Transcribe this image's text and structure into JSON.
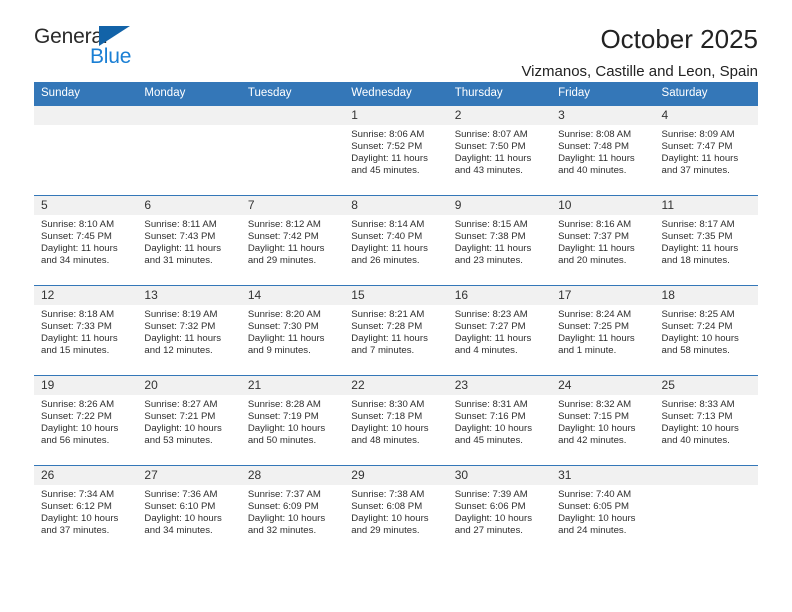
{
  "brand": {
    "name_part1": "General",
    "name_part2": "Blue",
    "triangle_icon": "triangle-icon",
    "accent_color": "#1a7fd4",
    "triangle_color": "#1263a8"
  },
  "header": {
    "title": "October 2025",
    "subtitle": "Vizmanos, Castille and Leon, Spain"
  },
  "calendar": {
    "header_bg": "#3477b8",
    "daynum_bg": "#f1f1f1",
    "weekday_headers": [
      "Sunday",
      "Monday",
      "Tuesday",
      "Wednesday",
      "Thursday",
      "Friday",
      "Saturday"
    ],
    "weeks": [
      [
        {
          "day": "",
          "lines": []
        },
        {
          "day": "",
          "lines": []
        },
        {
          "day": "",
          "lines": []
        },
        {
          "day": "1",
          "lines": [
            "Sunrise: 8:06 AM",
            "Sunset: 7:52 PM",
            "Daylight: 11 hours",
            "and 45 minutes."
          ]
        },
        {
          "day": "2",
          "lines": [
            "Sunrise: 8:07 AM",
            "Sunset: 7:50 PM",
            "Daylight: 11 hours",
            "and 43 minutes."
          ]
        },
        {
          "day": "3",
          "lines": [
            "Sunrise: 8:08 AM",
            "Sunset: 7:48 PM",
            "Daylight: 11 hours",
            "and 40 minutes."
          ]
        },
        {
          "day": "4",
          "lines": [
            "Sunrise: 8:09 AM",
            "Sunset: 7:47 PM",
            "Daylight: 11 hours",
            "and 37 minutes."
          ]
        }
      ],
      [
        {
          "day": "5",
          "lines": [
            "Sunrise: 8:10 AM",
            "Sunset: 7:45 PM",
            "Daylight: 11 hours",
            "and 34 minutes."
          ]
        },
        {
          "day": "6",
          "lines": [
            "Sunrise: 8:11 AM",
            "Sunset: 7:43 PM",
            "Daylight: 11 hours",
            "and 31 minutes."
          ]
        },
        {
          "day": "7",
          "lines": [
            "Sunrise: 8:12 AM",
            "Sunset: 7:42 PM",
            "Daylight: 11 hours",
            "and 29 minutes."
          ]
        },
        {
          "day": "8",
          "lines": [
            "Sunrise: 8:14 AM",
            "Sunset: 7:40 PM",
            "Daylight: 11 hours",
            "and 26 minutes."
          ]
        },
        {
          "day": "9",
          "lines": [
            "Sunrise: 8:15 AM",
            "Sunset: 7:38 PM",
            "Daylight: 11 hours",
            "and 23 minutes."
          ]
        },
        {
          "day": "10",
          "lines": [
            "Sunrise: 8:16 AM",
            "Sunset: 7:37 PM",
            "Daylight: 11 hours",
            "and 20 minutes."
          ]
        },
        {
          "day": "11",
          "lines": [
            "Sunrise: 8:17 AM",
            "Sunset: 7:35 PM",
            "Daylight: 11 hours",
            "and 18 minutes."
          ]
        }
      ],
      [
        {
          "day": "12",
          "lines": [
            "Sunrise: 8:18 AM",
            "Sunset: 7:33 PM",
            "Daylight: 11 hours",
            "and 15 minutes."
          ]
        },
        {
          "day": "13",
          "lines": [
            "Sunrise: 8:19 AM",
            "Sunset: 7:32 PM",
            "Daylight: 11 hours",
            "and 12 minutes."
          ]
        },
        {
          "day": "14",
          "lines": [
            "Sunrise: 8:20 AM",
            "Sunset: 7:30 PM",
            "Daylight: 11 hours",
            "and 9 minutes."
          ]
        },
        {
          "day": "15",
          "lines": [
            "Sunrise: 8:21 AM",
            "Sunset: 7:28 PM",
            "Daylight: 11 hours",
            "and 7 minutes."
          ]
        },
        {
          "day": "16",
          "lines": [
            "Sunrise: 8:23 AM",
            "Sunset: 7:27 PM",
            "Daylight: 11 hours",
            "and 4 minutes."
          ]
        },
        {
          "day": "17",
          "lines": [
            "Sunrise: 8:24 AM",
            "Sunset: 7:25 PM",
            "Daylight: 11 hours",
            "and 1 minute."
          ]
        },
        {
          "day": "18",
          "lines": [
            "Sunrise: 8:25 AM",
            "Sunset: 7:24 PM",
            "Daylight: 10 hours",
            "and 58 minutes."
          ]
        }
      ],
      [
        {
          "day": "19",
          "lines": [
            "Sunrise: 8:26 AM",
            "Sunset: 7:22 PM",
            "Daylight: 10 hours",
            "and 56 minutes."
          ]
        },
        {
          "day": "20",
          "lines": [
            "Sunrise: 8:27 AM",
            "Sunset: 7:21 PM",
            "Daylight: 10 hours",
            "and 53 minutes."
          ]
        },
        {
          "day": "21",
          "lines": [
            "Sunrise: 8:28 AM",
            "Sunset: 7:19 PM",
            "Daylight: 10 hours",
            "and 50 minutes."
          ]
        },
        {
          "day": "22",
          "lines": [
            "Sunrise: 8:30 AM",
            "Sunset: 7:18 PM",
            "Daylight: 10 hours",
            "and 48 minutes."
          ]
        },
        {
          "day": "23",
          "lines": [
            "Sunrise: 8:31 AM",
            "Sunset: 7:16 PM",
            "Daylight: 10 hours",
            "and 45 minutes."
          ]
        },
        {
          "day": "24",
          "lines": [
            "Sunrise: 8:32 AM",
            "Sunset: 7:15 PM",
            "Daylight: 10 hours",
            "and 42 minutes."
          ]
        },
        {
          "day": "25",
          "lines": [
            "Sunrise: 8:33 AM",
            "Sunset: 7:13 PM",
            "Daylight: 10 hours",
            "and 40 minutes."
          ]
        }
      ],
      [
        {
          "day": "26",
          "lines": [
            "Sunrise: 7:34 AM",
            "Sunset: 6:12 PM",
            "Daylight: 10 hours",
            "and 37 minutes."
          ]
        },
        {
          "day": "27",
          "lines": [
            "Sunrise: 7:36 AM",
            "Sunset: 6:10 PM",
            "Daylight: 10 hours",
            "and 34 minutes."
          ]
        },
        {
          "day": "28",
          "lines": [
            "Sunrise: 7:37 AM",
            "Sunset: 6:09 PM",
            "Daylight: 10 hours",
            "and 32 minutes."
          ]
        },
        {
          "day": "29",
          "lines": [
            "Sunrise: 7:38 AM",
            "Sunset: 6:08 PM",
            "Daylight: 10 hours",
            "and 29 minutes."
          ]
        },
        {
          "day": "30",
          "lines": [
            "Sunrise: 7:39 AM",
            "Sunset: 6:06 PM",
            "Daylight: 10 hours",
            "and 27 minutes."
          ]
        },
        {
          "day": "31",
          "lines": [
            "Sunrise: 7:40 AM",
            "Sunset: 6:05 PM",
            "Daylight: 10 hours",
            "and 24 minutes."
          ]
        },
        {
          "day": "",
          "lines": []
        }
      ]
    ]
  }
}
